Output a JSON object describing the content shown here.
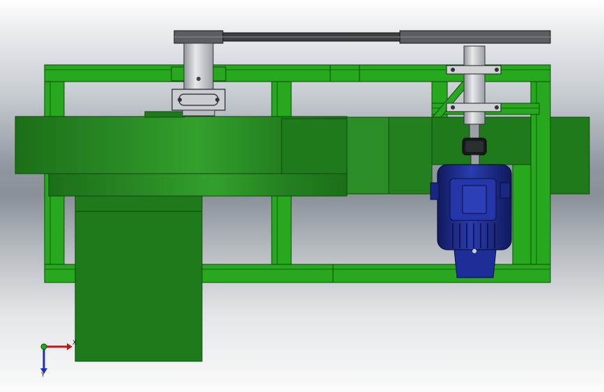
{
  "viewport": {
    "background_top": "#ffffff",
    "background_mid": "#8a9198"
  },
  "colors": {
    "frame_green": "#24a11a",
    "frame_green_dark": "#0f6a0c",
    "housing_green": "#1f7a1c",
    "housing_green_light": "#2f9a2a",
    "shaft_grey": "#b9bec3",
    "belt_dark": "#3a3d40",
    "motor_blue": "#1f2f9a",
    "motor_blue_dark": "#111c66",
    "coupling_black": "#15181a"
  },
  "triad": {
    "x_label": "X",
    "y_label": "Y",
    "x_color": "#c0151a",
    "y_color": "#1c2fb8",
    "origin_color": "#23a81c"
  }
}
